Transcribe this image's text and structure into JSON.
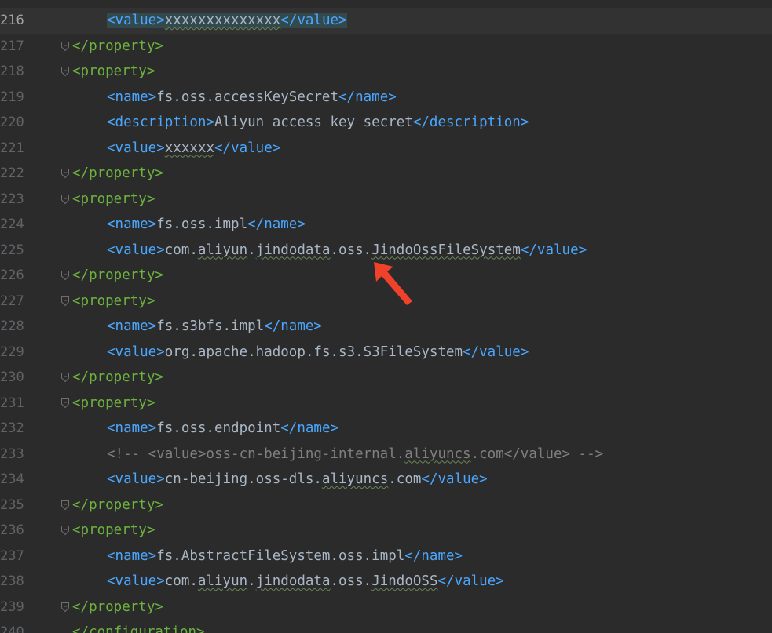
{
  "lines": [
    {
      "num": "216",
      "current": true,
      "fold": false,
      "indent": 1,
      "tokens": [
        {
          "t": "<value>",
          "c": "tagb",
          "hl": true
        },
        {
          "t": "xxxxxxxxxxxxxx",
          "c": "txt",
          "sq": true,
          "hl": true
        },
        {
          "t": "</value>",
          "c": "tagb",
          "hl": true
        }
      ]
    },
    {
      "num": "217",
      "fold": true,
      "indent": 0,
      "tokens": [
        {
          "t": "</property>",
          "c": "tagg"
        }
      ]
    },
    {
      "num": "218",
      "fold": true,
      "indent": 0,
      "tokens": [
        {
          "t": "<property>",
          "c": "tagg"
        }
      ]
    },
    {
      "num": "219",
      "indent": 1,
      "tokens": [
        {
          "t": "<name>",
          "c": "tagb"
        },
        {
          "t": "fs.oss.accessKeySecret",
          "c": "txt"
        },
        {
          "t": "</name>",
          "c": "tagb"
        }
      ]
    },
    {
      "num": "220",
      "indent": 1,
      "tokens": [
        {
          "t": "<description>",
          "c": "tagb"
        },
        {
          "t": "Aliyun access key secret",
          "c": "txt"
        },
        {
          "t": "</description>",
          "c": "tagb"
        }
      ]
    },
    {
      "num": "221",
      "indent": 1,
      "tokens": [
        {
          "t": "<value>",
          "c": "tagb"
        },
        {
          "t": "xxxxxx",
          "c": "txt",
          "sq": true
        },
        {
          "t": "</value>",
          "c": "tagb"
        }
      ]
    },
    {
      "num": "222",
      "fold": true,
      "indent": 0,
      "tokens": [
        {
          "t": "</property>",
          "c": "tagg"
        }
      ]
    },
    {
      "num": "223",
      "fold": true,
      "indent": 0,
      "tokens": [
        {
          "t": "<property>",
          "c": "tagg"
        }
      ]
    },
    {
      "num": "224",
      "indent": 1,
      "tokens": [
        {
          "t": "<name>",
          "c": "tagb"
        },
        {
          "t": "fs.oss.impl",
          "c": "txt"
        },
        {
          "t": "</name>",
          "c": "tagb"
        }
      ]
    },
    {
      "num": "225",
      "indent": 1,
      "tokens": [
        {
          "t": "<value>",
          "c": "tagb"
        },
        {
          "t": "com.",
          "c": "txt"
        },
        {
          "t": "aliyun",
          "c": "txt",
          "sq": true
        },
        {
          "t": ".",
          "c": "txt"
        },
        {
          "t": "jindodata",
          "c": "txt",
          "sq": true
        },
        {
          "t": ".oss.",
          "c": "txt"
        },
        {
          "t": "JindoOssFileSystem",
          "c": "txt",
          "sq": true
        },
        {
          "t": "</value>",
          "c": "tagb"
        }
      ]
    },
    {
      "num": "226",
      "fold": true,
      "indent": 0,
      "tokens": [
        {
          "t": "</property>",
          "c": "tagg"
        }
      ]
    },
    {
      "num": "227",
      "fold": true,
      "indent": 0,
      "tokens": [
        {
          "t": "<property>",
          "c": "tagg"
        }
      ]
    },
    {
      "num": "228",
      "indent": 1,
      "tokens": [
        {
          "t": "<name>",
          "c": "tagb"
        },
        {
          "t": "fs.s3bfs.impl",
          "c": "txt"
        },
        {
          "t": "</name>",
          "c": "tagb"
        }
      ]
    },
    {
      "num": "229",
      "indent": 1,
      "tokens": [
        {
          "t": "<value>",
          "c": "tagb"
        },
        {
          "t": "org.apache.hadoop.fs.s3.S3FileSystem",
          "c": "txt"
        },
        {
          "t": "</value>",
          "c": "tagb"
        }
      ]
    },
    {
      "num": "230",
      "fold": true,
      "indent": 0,
      "tokens": [
        {
          "t": "</property>",
          "c": "tagg"
        }
      ]
    },
    {
      "num": "231",
      "fold": true,
      "indent": 0,
      "tokens": [
        {
          "t": "<property>",
          "c": "tagg"
        }
      ]
    },
    {
      "num": "232",
      "indent": 1,
      "tokens": [
        {
          "t": "<name>",
          "c": "tagb"
        },
        {
          "t": "fs.oss.endpoint",
          "c": "txt"
        },
        {
          "t": "</name>",
          "c": "tagb"
        }
      ]
    },
    {
      "num": "233",
      "indent": 1,
      "tokens": [
        {
          "t": "<!-- <value>oss-cn-beijing-internal.",
          "c": "cmt"
        },
        {
          "t": "aliyuncs",
          "c": "cmt",
          "sq": true
        },
        {
          "t": ".com</value> -->",
          "c": "cmt"
        }
      ]
    },
    {
      "num": "234",
      "indent": 1,
      "tokens": [
        {
          "t": "<value>",
          "c": "tagb"
        },
        {
          "t": "cn-beijing.oss-dls.",
          "c": "txt"
        },
        {
          "t": "aliyuncs",
          "c": "txt",
          "sq": true
        },
        {
          "t": ".com",
          "c": "txt"
        },
        {
          "t": "</value>",
          "c": "tagb"
        }
      ]
    },
    {
      "num": "235",
      "fold": true,
      "indent": 0,
      "tokens": [
        {
          "t": "</property>",
          "c": "tagg"
        }
      ]
    },
    {
      "num": "236",
      "fold": true,
      "indent": 0,
      "tokens": [
        {
          "t": "<property>",
          "c": "tagg"
        }
      ]
    },
    {
      "num": "237",
      "indent": 1,
      "tokens": [
        {
          "t": "<name>",
          "c": "tagb"
        },
        {
          "t": "fs.AbstractFileSystem.oss.impl",
          "c": "txt"
        },
        {
          "t": "</name>",
          "c": "tagb"
        }
      ]
    },
    {
      "num": "238",
      "indent": 1,
      "tokens": [
        {
          "t": "<value>",
          "c": "tagb"
        },
        {
          "t": "com.",
          "c": "txt"
        },
        {
          "t": "aliyun",
          "c": "txt",
          "sq": true
        },
        {
          "t": ".",
          "c": "txt"
        },
        {
          "t": "jindodata",
          "c": "txt",
          "sq": true
        },
        {
          "t": ".oss.",
          "c": "txt"
        },
        {
          "t": "JindoOSS",
          "c": "txt",
          "sq": true
        },
        {
          "t": "</value>",
          "c": "tagb"
        }
      ]
    },
    {
      "num": "239",
      "fold": true,
      "indent": 0,
      "tokens": [
        {
          "t": "</property>",
          "c": "tagg"
        }
      ]
    },
    {
      "num": "240",
      "indent": 0,
      "tokens": [
        {
          "t": "</configuration>",
          "c": "tagg"
        }
      ]
    }
  ],
  "annotation": {
    "icon": "red-arrow-icon",
    "color": "#f0412a"
  }
}
